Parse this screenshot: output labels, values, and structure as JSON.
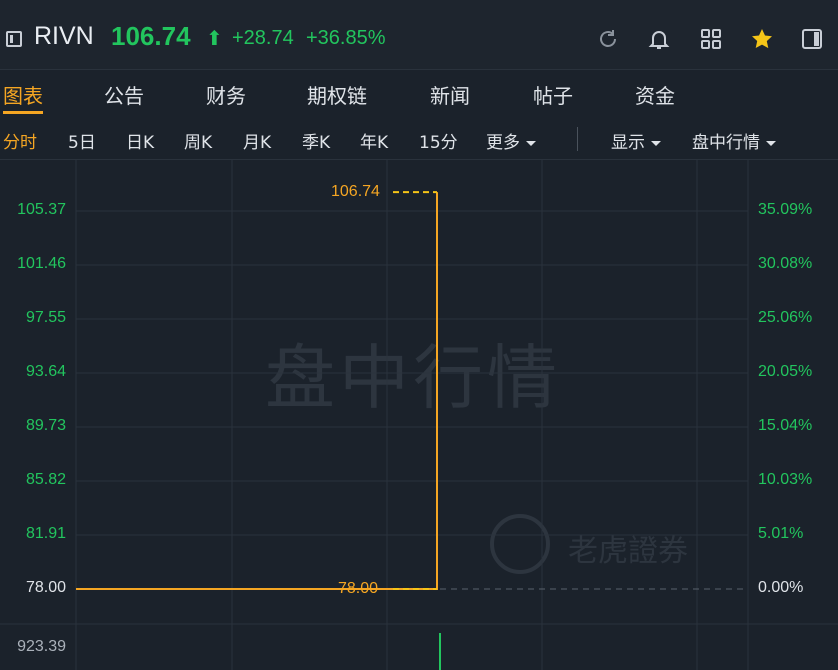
{
  "header": {
    "ticker": "RIVN",
    "price": "106.74",
    "change": "+28.74",
    "change_pct": "+36.85%",
    "icons": [
      "sidebar-toggle-icon",
      "refresh-icon",
      "bell-icon",
      "grid-icon",
      "star-icon",
      "panel-icon"
    ]
  },
  "tabs": [
    "图表",
    "公告",
    "财务",
    "期权链",
    "新闻",
    "帖子",
    "资金"
  ],
  "periods": [
    "分时",
    "5日",
    "日K",
    "周K",
    "月K",
    "季K",
    "年K",
    "15分"
  ],
  "more_label": "更多",
  "display_label": "显示",
  "session_label": "盘中行情",
  "watermark": "盘中行情",
  "brand": "老虎證券",
  "colors": {
    "up": "#22c55e",
    "accent": "#f5a623",
    "bg": "#1b222b"
  },
  "chart_data": {
    "type": "line",
    "y_left_ticks": [
      "105.37",
      "101.46",
      "97.55",
      "93.64",
      "89.73",
      "85.82",
      "81.91",
      "78.00"
    ],
    "y_right_ticks": [
      "35.09%",
      "30.08%",
      "25.06%",
      "20.05%",
      "15.04%",
      "10.03%",
      "5.01%",
      "0.00%"
    ],
    "ylim": [
      78.0,
      106.74
    ],
    "prev_close": 78.0,
    "high_label": "106.74",
    "low_label": "78.00",
    "series": [
      {
        "values": [
          78.0,
          78.0,
          78.0,
          78.0,
          106.74
        ]
      }
    ],
    "volume_label": "923.39"
  }
}
